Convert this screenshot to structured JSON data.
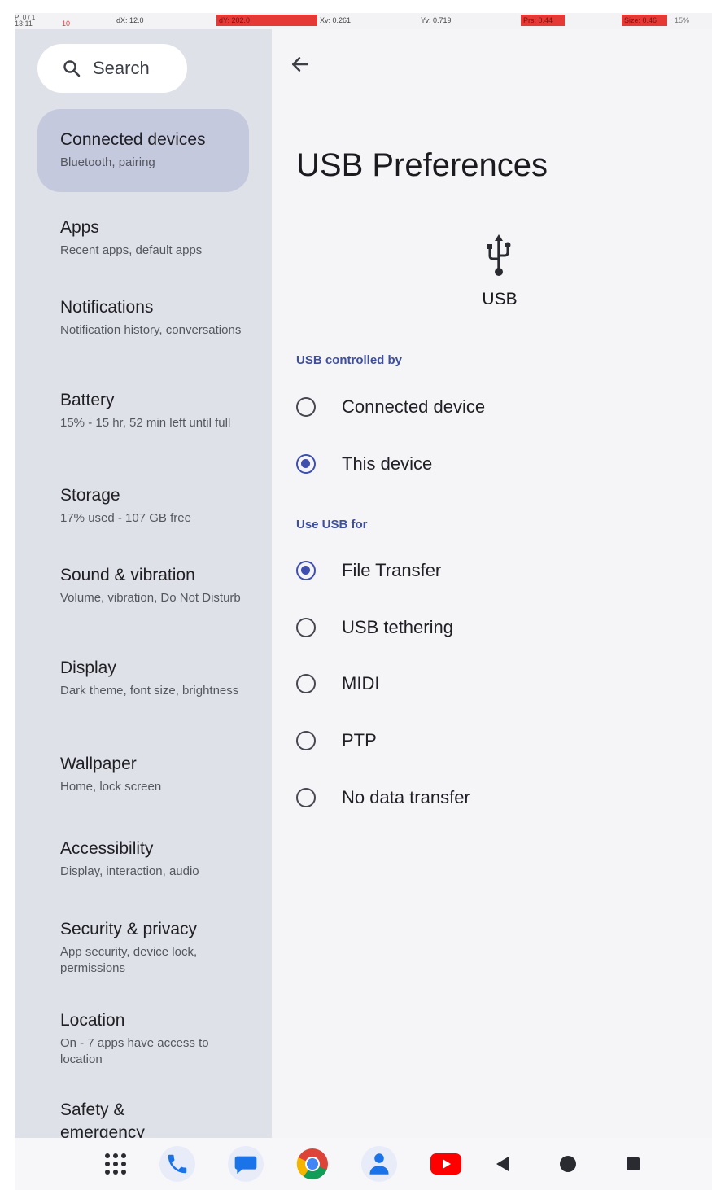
{
  "status_bar": {
    "time": "13:11",
    "rec": "10",
    "p_label": "P: 0 / 1",
    "dx": "dX: 12.0",
    "dy": "dY: 202.0",
    "xv": "Xv: 0.261",
    "yv": "Yv: 0.719",
    "prs": "Prs: 0.44",
    "size": "Size: 0.46",
    "battery": "15%"
  },
  "sidebar": {
    "search_label": "Search",
    "items": [
      {
        "title": "Connected devices",
        "sub": "Bluetooth, pairing"
      },
      {
        "title": "Apps",
        "sub": "Recent apps, default apps"
      },
      {
        "title": "Notifications",
        "sub": "Notification history, conversations"
      },
      {
        "title": "Battery",
        "sub": "15% - 15 hr, 52 min left until full"
      },
      {
        "title": "Storage",
        "sub": "17% used - 107 GB free"
      },
      {
        "title": "Sound & vibration",
        "sub": "Volume, vibration, Do Not Disturb"
      },
      {
        "title": "Display",
        "sub": "Dark theme, font size, brightness"
      },
      {
        "title": "Wallpaper",
        "sub": "Home, lock screen"
      },
      {
        "title": "Accessibility",
        "sub": "Display, interaction, audio"
      },
      {
        "title": "Security & privacy",
        "sub": "App security, device lock, permissions"
      },
      {
        "title": "Location",
        "sub": "On - 7 apps have access to location"
      },
      {
        "title": "Safety & emergency",
        "sub": ""
      }
    ]
  },
  "main": {
    "title": "USB Preferences",
    "usb_label": "USB",
    "controlled_by": {
      "label": "USB controlled by",
      "options": [
        "Connected device",
        "This device"
      ],
      "selected": "This device"
    },
    "use_for": {
      "label": "Use USB for",
      "options": [
        "File Transfer",
        "USB tethering",
        "MIDI",
        "PTP",
        "No data transfer"
      ],
      "selected": "File Transfer"
    }
  },
  "colors": {
    "accent": "#3e4fb0",
    "sidebar_bg": "#dfe1e8",
    "active_item_bg": "#c4c9de"
  },
  "dock": {
    "icons": [
      "app-drawer-icon",
      "phone-icon",
      "messages-icon",
      "chrome-icon",
      "contacts-icon",
      "youtube-icon",
      "back-nav-icon",
      "home-nav-icon",
      "recents-nav-icon"
    ]
  }
}
